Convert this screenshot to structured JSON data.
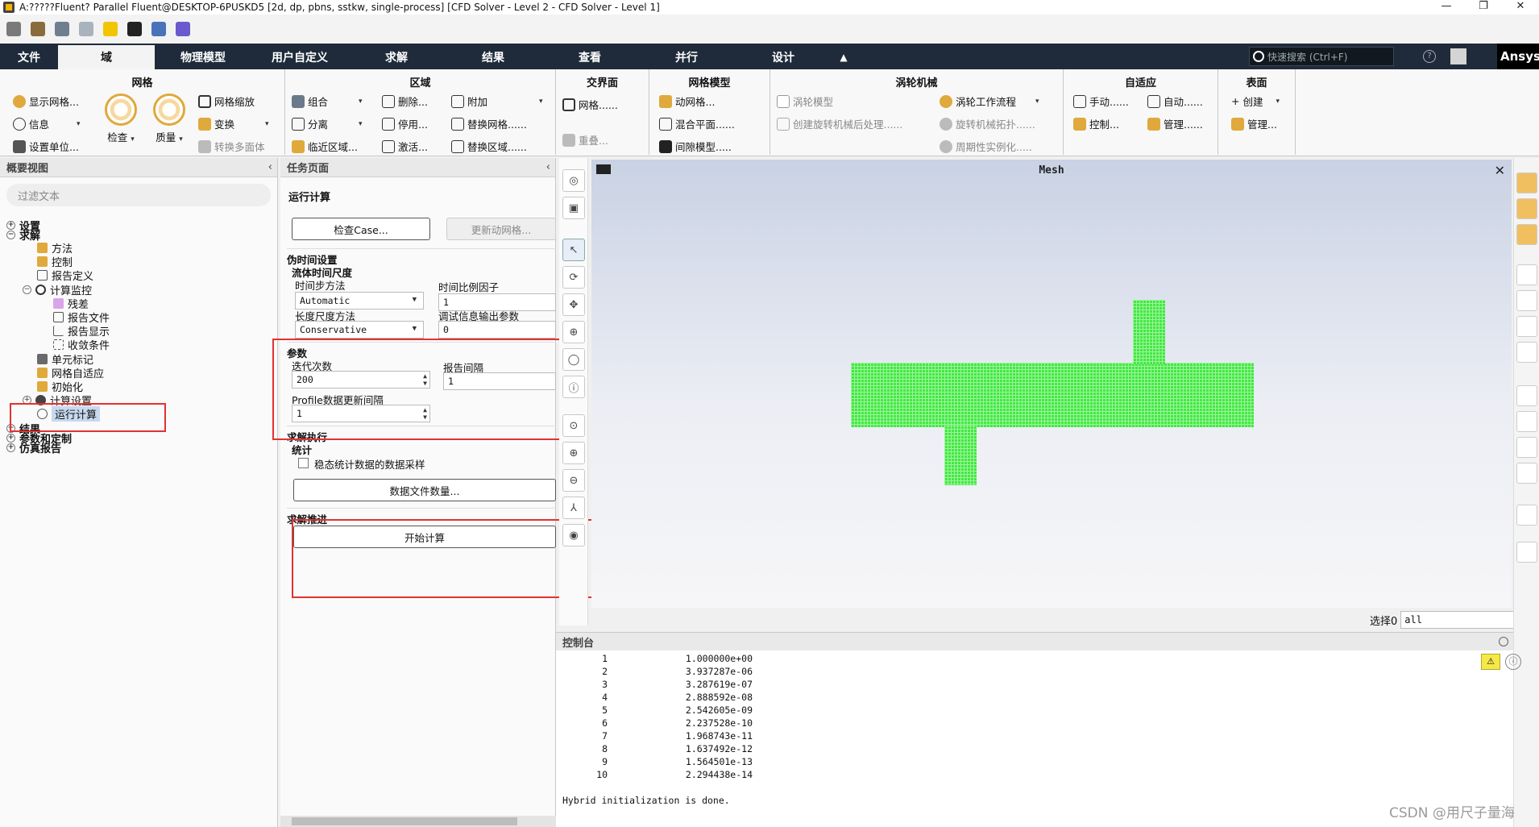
{
  "window": {
    "title": "A:?????Fluent? Parallel Fluent@DESKTOP-6PUSKD5  [2d, dp, pbns, sstkw, single-process] [CFD Solver - Level 2 - CFD Solver - Level 1]",
    "minimize": "—",
    "maximize": "❐",
    "close": "✕"
  },
  "menu": {
    "tabs": [
      "文件",
      "域",
      "物理模型",
      "用户自定义",
      "求解",
      "结果",
      "查看",
      "并行",
      "设计"
    ],
    "active": "域",
    "collapse": "▲",
    "search_placeholder": "快速搜索 (Ctrl+F)",
    "logo": "Ansys"
  },
  "ribbon": {
    "mesh": {
      "title": "网格",
      "show_mesh": "显示网格...",
      "info": "信息",
      "set_units": "设置单位...",
      "check": "检查",
      "quality": "质量",
      "scale": "网格缩放",
      "transform": "变换",
      "to_polyhedra": "转换多面体"
    },
    "zones": {
      "title": "区域",
      "combine": "组合",
      "separate": "分离",
      "adjacency": "临近区域...",
      "delete": "删除...",
      "deactivate": "停用...",
      "activate": "激活...",
      "append": "附加",
      "replace_mesh": "替换网格......",
      "replace_zone": "替换区域......"
    },
    "interfaces": {
      "title": "交界面",
      "mesh": "网格......",
      "overlap": "重叠..."
    },
    "mesh_models": {
      "title": "网格模型",
      "dynamic_mesh": "动网格...",
      "mixing_plane": "混合平面......",
      "gap_model": "间隙模型....."
    },
    "turbo": {
      "title": "涡轮机械",
      "turbo_model": "涡轮模型",
      "post_process": "创建旋转机械后处理......",
      "workflow": "涡轮工作流程",
      "topology": "旋转机械拓扑......",
      "periodic": "周期性实例化....."
    },
    "adapt": {
      "title": "自适应",
      "manual": "手动......",
      "auto": "自动......",
      "controls": "控制...",
      "manage": "管理......"
    },
    "surface": {
      "title": "表面",
      "create": "创建",
      "manage": "管理..."
    }
  },
  "outline": {
    "header": "概要视图",
    "filter_placeholder": "过滤文本",
    "collapse_arrow": "‹",
    "nodes": {
      "setup": "设置",
      "solution": "求解",
      "methods": "方法",
      "controls": "控制",
      "report_defs": "报告定义",
      "monitors": "计算监控",
      "residuals": "残差",
      "report_files": "报告文件",
      "report_plots": "报告显示",
      "convergence": "收敛条件",
      "cell_registers": "单元标记",
      "mesh_adapt": "网格自适应",
      "init": "初始化",
      "calc_activities": "计算设置",
      "run_calc": "运行计算",
      "results": "结果",
      "params": "参数和定制",
      "report": "仿真报告"
    }
  },
  "task": {
    "header": "任务页面",
    "collapse_arrow": "‹",
    "title": "运行计算",
    "check_case": "检查Case...",
    "update_dynamic_mesh": "更新动网格...",
    "pseudo_time": "伪时间设置",
    "fluid_time_scale": "流体时间尺度",
    "time_step_method_label": "时间步方法",
    "time_step_method": "Automatic",
    "time_scale_factor_label": "时间比例因子",
    "time_scale_factor": "1",
    "length_scale_method_label": "长度尺度方法",
    "length_scale_method": "Conservative",
    "verbosity_label": "调试信息输出参数",
    "verbosity": "0",
    "params": "参数",
    "iterations_label": "迭代次数",
    "iterations": "200",
    "report_interval_label": "报告间隔",
    "report_interval": "1",
    "profile_interval_label": "Profile数据更新间隔",
    "profile_interval": "1",
    "solution_processing": "求解执行",
    "statistics": "统计",
    "data_sampling": "稳态统计数据的数据采样",
    "data_file_quantities": "数据文件数量...",
    "advancement": "求解推进",
    "calculate": "开始计算"
  },
  "graphics": {
    "title": "Mesh",
    "close": "✕",
    "select_label": "选择0",
    "select_value": "all"
  },
  "console": {
    "header": "控制台",
    "rows": [
      {
        "iter": "1",
        "val": "1.000000e+00"
      },
      {
        "iter": "2",
        "val": "3.937287e-06"
      },
      {
        "iter": "3",
        "val": "3.287619e-07"
      },
      {
        "iter": "4",
        "val": "2.888592e-08"
      },
      {
        "iter": "5",
        "val": "2.542605e-09"
      },
      {
        "iter": "6",
        "val": "2.237528e-10"
      },
      {
        "iter": "7",
        "val": "1.968743e-11"
      },
      {
        "iter": "8",
        "val": "1.637492e-12"
      },
      {
        "iter": "9",
        "val": "1.564501e-13"
      },
      {
        "iter": "10",
        "val": "2.294438e-14"
      }
    ],
    "message": "Hybrid initialization is done.",
    "warn": "⚠",
    "info": "ⓘ"
  },
  "watermark": "CSDN @用尺子量海",
  "colors": {
    "menu_bg": "#1f2b3a",
    "mesh_green": "#43e843",
    "highlight_red": "#e23232",
    "tree_selection": "#c7d9ef"
  },
  "icons": [
    "check-icon",
    "quality-icon",
    "pointer-icon",
    "rotate-icon",
    "pan-icon",
    "zoom-icon",
    "info-icon",
    "fit-icon",
    "warning-icon"
  ]
}
